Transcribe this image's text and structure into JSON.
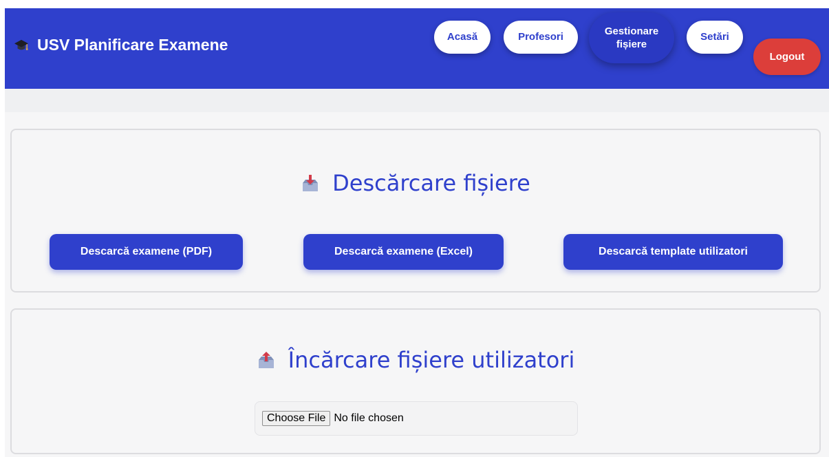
{
  "header": {
    "brand_title": "USV Planificare Examene",
    "brand_icon": "graduation-cap-icon",
    "nav": [
      {
        "label": "Acasă"
      },
      {
        "label": "Profesori"
      },
      {
        "label": "Gestionare fișiere",
        "active": true
      },
      {
        "label": "Setări"
      }
    ],
    "logout_label": "Logout"
  },
  "download_section": {
    "title": "Descărcare fișiere",
    "icon": "inbox-tray-icon",
    "buttons": [
      {
        "label": "Descarcă examene (PDF)"
      },
      {
        "label": "Descarcă examene (Excel)"
      },
      {
        "label": "Descarcă template utilizatori"
      }
    ]
  },
  "upload_section": {
    "title": "Încărcare fișiere utilizatori",
    "icon": "outbox-tray-icon",
    "file_input": {
      "button_label": "Choose File",
      "status_text": "No file chosen"
    }
  },
  "colors": {
    "primary": "#2f40cc",
    "danger": "#dc3e3a",
    "background": "#f6f6f7"
  }
}
